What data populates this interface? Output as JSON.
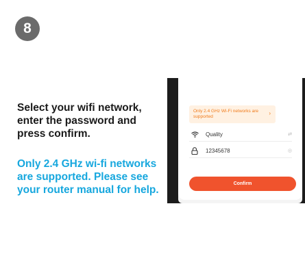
{
  "step": {
    "number": "8"
  },
  "instructions": {
    "main": "Select your wifi network, enter the password and press confirm.",
    "note": "Only 2.4 GHz wi-fi networks are supported. Please see your router manual for help."
  },
  "phone": {
    "warning": "Only 2.4 GHz Wi-Fi networks are supported",
    "network": {
      "name": "Quality",
      "trail": "⇄"
    },
    "password": {
      "value": "12345678",
      "trail": "◎"
    },
    "confirm_label": "Confirm",
    "colors": {
      "accent": "#f0532d",
      "warning_text": "#f07b1b",
      "note": "#16a7de"
    }
  }
}
